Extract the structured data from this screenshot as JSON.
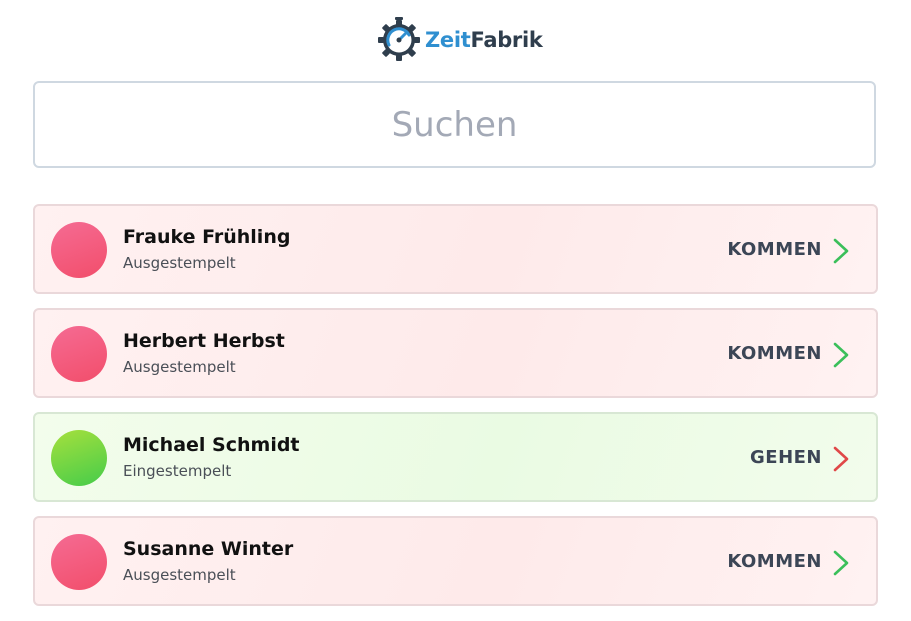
{
  "logo": {
    "part1": "Zeit",
    "part2": "Fabrik"
  },
  "search": {
    "placeholder": "Suchen",
    "value": ""
  },
  "employees": [
    {
      "name": "Frauke Frühling",
      "status": "Ausgestempelt",
      "action": "KOMMEN",
      "state": "out"
    },
    {
      "name": "Herbert Herbst",
      "status": "Ausgestempelt",
      "action": "KOMMEN",
      "state": "out"
    },
    {
      "name": "Michael Schmidt",
      "status": "Eingestempelt",
      "action": "GEHEN",
      "state": "in"
    },
    {
      "name": "Susanne Winter",
      "status": "Ausgestempelt",
      "action": "KOMMEN",
      "state": "out"
    }
  ],
  "colors": {
    "brand_blue": "#2f8fd0",
    "brand_dark": "#2f3e4d",
    "out_avatar": "#f2577a",
    "in_avatar": "#6ad646",
    "kommen_chevron": "#3bbf5a",
    "gehen_chevron": "#e04848"
  },
  "icons": {
    "logo": "stopwatch-gear-icon",
    "kommen": "chevron-right-icon",
    "gehen": "chevron-right-icon"
  }
}
